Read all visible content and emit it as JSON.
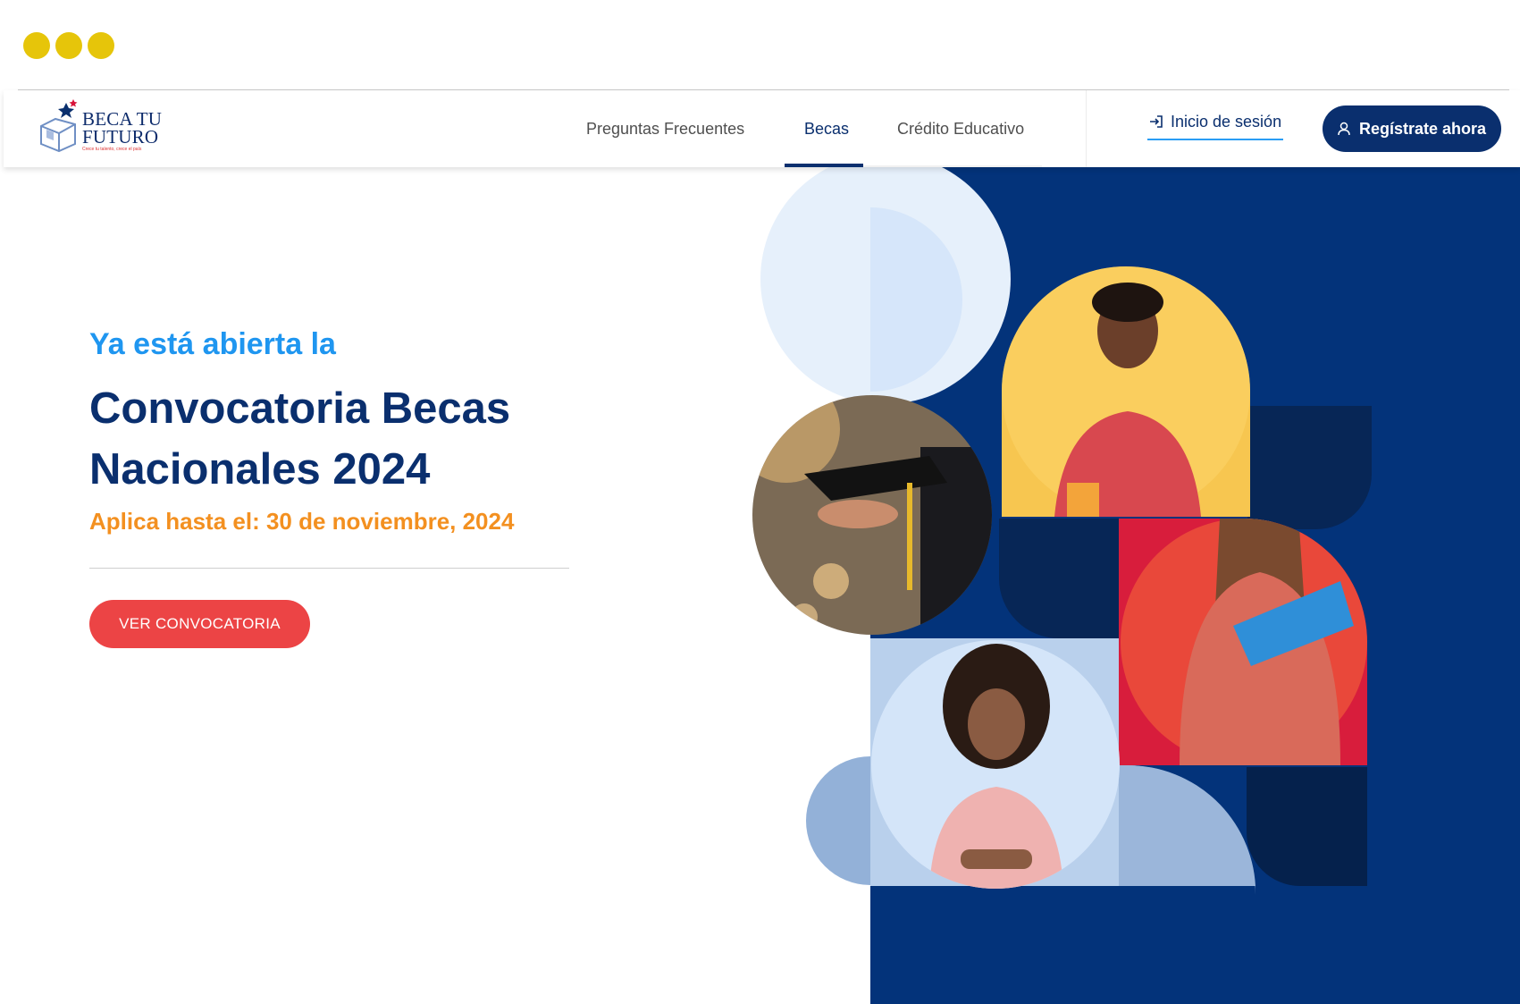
{
  "window": {
    "controls": [
      "dot",
      "dot",
      "dot"
    ],
    "control_color": "#e6c50a"
  },
  "brand": {
    "name": "BECA TU\nFUTURO",
    "slogan": "Crece tu talento, crece el país",
    "logo_icon": "box-with-star-icon"
  },
  "nav": {
    "links": [
      {
        "label": "Preguntas Frecuentes",
        "active": false
      },
      {
        "label": "Becas",
        "active": true
      },
      {
        "label": "Crédito Educativo",
        "active": false
      }
    ],
    "login_label": "Inicio de sesión",
    "login_icon": "sign-in-icon",
    "register_label": "Regístrate ahora",
    "register_icon": "user-icon"
  },
  "hero": {
    "eyebrow": "Ya está abierta la",
    "headline": "Convocatoria Becas Nacionales 2024",
    "deadline": "Aplica hasta el: 30 de noviembre, 2024",
    "cta_label": "VER CONVOCATORIA"
  },
  "colors": {
    "navy": "#0a2f6e",
    "sky_blue": "#1f96f0",
    "orange": "#f39020",
    "coral": "#ec4445",
    "yellow": "#f7c650",
    "red": "#d81d3c",
    "light_blue": "#cfe1f7",
    "dark_navy": "#07265a"
  }
}
